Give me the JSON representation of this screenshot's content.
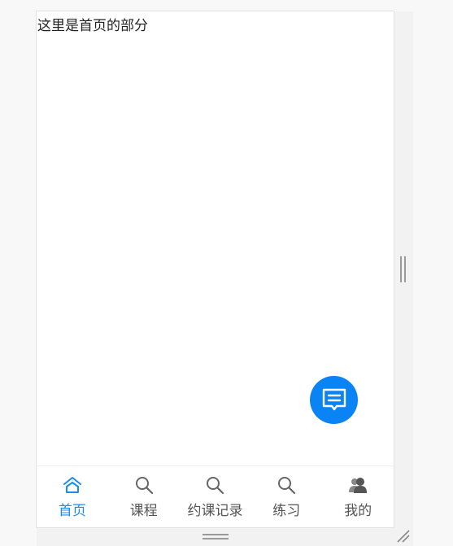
{
  "page": {
    "home_text": "这里是首页的部分"
  },
  "tabbar": {
    "active_color": "#1a8cf0",
    "inactive_color": "#555555",
    "items": [
      {
        "label": "首页",
        "icon": "home-icon",
        "active": true
      },
      {
        "label": "课程",
        "icon": "search-icon",
        "active": false
      },
      {
        "label": "约课记录",
        "icon": "search-icon",
        "active": false
      },
      {
        "label": "练习",
        "icon": "search-icon",
        "active": false
      },
      {
        "label": "我的",
        "icon": "user-icon",
        "active": false
      }
    ]
  },
  "fab": {
    "icon": "message-icon",
    "color": "#0a84f5"
  }
}
